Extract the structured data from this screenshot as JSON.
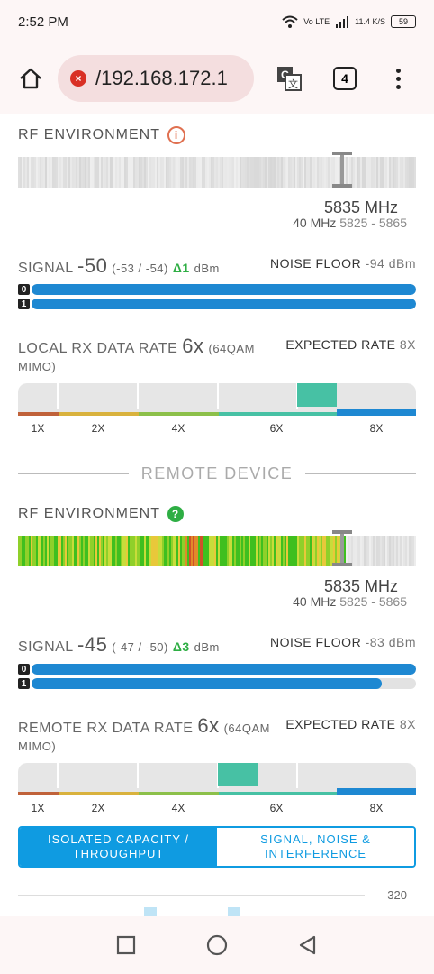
{
  "status": {
    "time": "2:52 PM",
    "net": "Vo LTE",
    "speed": "11.4 K/S",
    "battery": "59"
  },
  "browser": {
    "url": "/192.168.172.1",
    "tab_count": "4"
  },
  "local": {
    "rf_title": "RF ENVIRONMENT",
    "freq": "5835 MHz",
    "width": "40 MHz",
    "range": "5825 - 5865",
    "signal_label": "SIGNAL",
    "signal_value": "-50",
    "signal_chains": "(-53 / -54)",
    "signal_delta": "Δ1",
    "signal_unit": "dBm",
    "noise_label": "NOISE FLOOR",
    "noise_value": "-94 dBm",
    "chains": [
      {
        "id": "0",
        "level": 1.0
      },
      {
        "id": "1",
        "level": 1.0
      }
    ],
    "rate_label": "LOCAL RX DATA RATE",
    "rate_value": "6x",
    "rate_mod": "(64QAM",
    "rate_mode": "MIMO)",
    "expected_label": "EXPECTED RATE",
    "expected_value": "8X"
  },
  "remote": {
    "divider": "REMOTE DEVICE",
    "rf_title": "RF ENVIRONMENT",
    "freq": "5835 MHz",
    "width": "40 MHz",
    "range": "5825 - 5865",
    "signal_label": "SIGNAL",
    "signal_value": "-45",
    "signal_chains": "(-47 / -50)",
    "signal_delta": "Δ3",
    "signal_unit": "dBm",
    "noise_label": "NOISE FLOOR",
    "noise_value": "-83 dBm",
    "chains": [
      {
        "id": "0",
        "level": 1.0
      },
      {
        "id": "1",
        "level": 0.91
      }
    ],
    "rate_label": "REMOTE RX DATA RATE",
    "rate_value": "6x",
    "rate_mod": "(64QAM",
    "rate_mode": "MIMO)",
    "expected_label": "EXPECTED RATE",
    "expected_value": "8X"
  },
  "rate_scale": [
    "1X",
    "2X",
    "4X",
    "6X",
    "8X"
  ],
  "toggle": {
    "left": "ISOLATED CAPACITY / THROUGHPUT",
    "right": "SIGNAL, NOISE & INTERFERENCE"
  },
  "chart": {
    "top_value": "320"
  },
  "colors": {
    "accent": "#0f9be1",
    "signal_bar": "#1e88d2",
    "rate_active": "#47c1a4",
    "good": "#2eae44"
  }
}
